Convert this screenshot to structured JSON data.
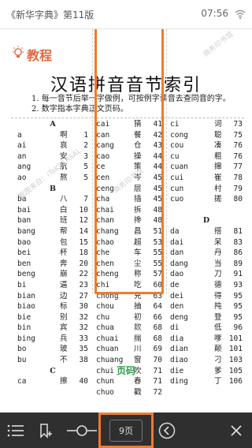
{
  "status_bar": {
    "book_title": "《新华字典》第11版",
    "time": "07:56"
  },
  "content": {
    "section_title": "教程",
    "index_title": "汉语拼音音节索引",
    "notes": [
      "1. 每一音节后举一字做例，可按例字读音去查同音的字。",
      "2. 数字指本字典正文页码。"
    ],
    "watermarks": [
      {
        "text": "截图来自：iTaK51RSAL",
        "style": "gray"
      },
      {
        "text": "商务印书馆",
        "style": "gray"
      },
      {
        "text": "商务印书馆",
        "style": "gray"
      }
    ],
    "columns": [
      {
        "rows": [
          {
            "type": "head",
            "text": "A"
          },
          {
            "py": "a",
            "ch": "啊",
            "pg": "1"
          },
          {
            "py": "ai",
            "ch": "哀",
            "pg": "2"
          },
          {
            "py": "an",
            "ch": "安",
            "pg": "3"
          },
          {
            "py": "ang",
            "ch": "肮",
            "pg": "5"
          },
          {
            "py": "ao",
            "ch": "熬",
            "pg": "5"
          },
          {
            "type": "head",
            "text": "B"
          },
          {
            "py": "ba",
            "ch": "八",
            "pg": "7"
          },
          {
            "py": "bai",
            "ch": "白",
            "pg": "10"
          },
          {
            "py": "ban",
            "ch": "班",
            "pg": "12"
          },
          {
            "py": "bang",
            "ch": "帮",
            "pg": "14"
          },
          {
            "py": "bao",
            "ch": "包",
            "pg": "15"
          },
          {
            "py": "bei",
            "ch": "杯",
            "pg": "18"
          },
          {
            "py": "ben",
            "ch": "奔",
            "pg": "20"
          },
          {
            "py": "beng",
            "ch": "崩",
            "pg": "22"
          },
          {
            "py": "bi",
            "ch": "逼",
            "pg": "23"
          },
          {
            "py": "bian",
            "ch": "边",
            "pg": "27"
          },
          {
            "py": "biao",
            "ch": "标",
            "pg": "30"
          },
          {
            "py": "bie",
            "ch": "别",
            "pg": "32"
          },
          {
            "py": "bin",
            "ch": "宾",
            "pg": "32"
          },
          {
            "py": "bing",
            "ch": "兵",
            "pg": "33"
          },
          {
            "py": "bo",
            "ch": "玻",
            "pg": "35"
          },
          {
            "py": "bu",
            "ch": "不",
            "pg": "38"
          },
          {
            "type": "head",
            "text": "C"
          },
          {
            "py": "ca",
            "ch": "擦",
            "pg": "40"
          }
        ]
      },
      {
        "rows": [
          {
            "py": "cai",
            "ch": "猜",
            "pg": "41"
          },
          {
            "py": "can",
            "ch": "餐",
            "pg": "42"
          },
          {
            "py": "cang",
            "ch": "仓",
            "pg": "43"
          },
          {
            "py": "cao",
            "ch": "操",
            "pg": "44"
          },
          {
            "py": "ce",
            "ch": "策",
            "pg": "44"
          },
          {
            "py": "cen",
            "ch": "岑",
            "pg": "45"
          },
          {
            "py": "ceng",
            "ch": "层",
            "pg": "45"
          },
          {
            "py": "cha",
            "ch": "插",
            "pg": "45"
          },
          {
            "py": "chai",
            "ch": "拆",
            "pg": "48"
          },
          {
            "py": "chan",
            "ch": "搀",
            "pg": "48"
          },
          {
            "py": "chang",
            "ch": "昌",
            "pg": "51"
          },
          {
            "py": "chao",
            "ch": "超",
            "pg": "53"
          },
          {
            "py": "che",
            "ch": "车",
            "pg": "55"
          },
          {
            "py": "chen",
            "ch": "尘",
            "pg": "55"
          },
          {
            "py": "cheng",
            "ch": "称",
            "pg": "57"
          },
          {
            "py": "chi",
            "ch": "吃",
            "pg": "60"
          },
          {
            "py": "chong",
            "ch": "充",
            "pg": "63"
          },
          {
            "py": "chou",
            "ch": "抽",
            "pg": "64"
          },
          {
            "py": "chu",
            "ch": "初",
            "pg": "66"
          },
          {
            "py": "chua",
            "ch": "欻",
            "pg": "68"
          },
          {
            "py": "chuai",
            "ch": "揣",
            "pg": "68"
          },
          {
            "py": "chuan",
            "ch": "川",
            "pg": "69"
          },
          {
            "py": "chuang",
            "ch": "窗",
            "pg": "70"
          },
          {
            "py": "chui",
            "ch": "吹",
            "pg": "71"
          },
          {
            "py": "chun",
            "ch": "春",
            "pg": "71"
          },
          {
            "py": "chuo",
            "ch": "戳",
            "pg": "72"
          }
        ]
      },
      {
        "rows": [
          {
            "py": "ci",
            "ch": "词",
            "pg": "73"
          },
          {
            "py": "cong",
            "ch": "聪",
            "pg": "75"
          },
          {
            "py": "cou",
            "ch": "凑",
            "pg": "76"
          },
          {
            "py": "cu",
            "ch": "粗",
            "pg": "76"
          },
          {
            "py": "cuan",
            "ch": "撺",
            "pg": "77"
          },
          {
            "py": "cui",
            "ch": "崔",
            "pg": "78"
          },
          {
            "py": "cun",
            "ch": "村",
            "pg": "79"
          },
          {
            "py": "cuo",
            "ch": "搓",
            "pg": "80"
          },
          {
            "type": "blank"
          },
          {
            "type": "head",
            "text": "D"
          },
          {
            "py": "da",
            "ch": "搭",
            "pg": "81"
          },
          {
            "py": "dai",
            "ch": "呆",
            "pg": "83"
          },
          {
            "py": "dan",
            "ch": "丹",
            "pg": "86"
          },
          {
            "py": "dang",
            "ch": "当",
            "pg": "89"
          },
          {
            "py": "dao",
            "ch": "刀",
            "pg": "91"
          },
          {
            "py": "de",
            "ch": "德",
            "pg": "93"
          },
          {
            "py": "dei",
            "ch": "得",
            "pg": "95"
          },
          {
            "py": "den",
            "ch": "扽",
            "pg": "95"
          },
          {
            "py": "deng",
            "ch": "登",
            "pg": "95"
          },
          {
            "py": "di",
            "ch": "低",
            "pg": "96"
          },
          {
            "py": "dia",
            "ch": "嗲",
            "pg": "101"
          },
          {
            "py": "dian",
            "ch": "颠",
            "pg": "101"
          },
          {
            "py": "diao",
            "ch": "刁",
            "pg": "103"
          },
          {
            "py": "die",
            "ch": "爹",
            "pg": "105"
          },
          {
            "py": "ding",
            "ch": "丁",
            "pg": "106"
          }
        ]
      }
    ],
    "caption": "页码"
  },
  "toolbar": {
    "page_label": "9页"
  },
  "colors": {
    "accent": "#f27a2e",
    "section_title": "#e36a43",
    "caption": "#2d9e48",
    "toolbar_bg": "#2f2f2f"
  },
  "icons": [
    "wifi-icon",
    "bulb-icon",
    "menu-list-icon",
    "bookmark-add-icon",
    "slider-icon",
    "back-circle-icon",
    "close-icon"
  ]
}
